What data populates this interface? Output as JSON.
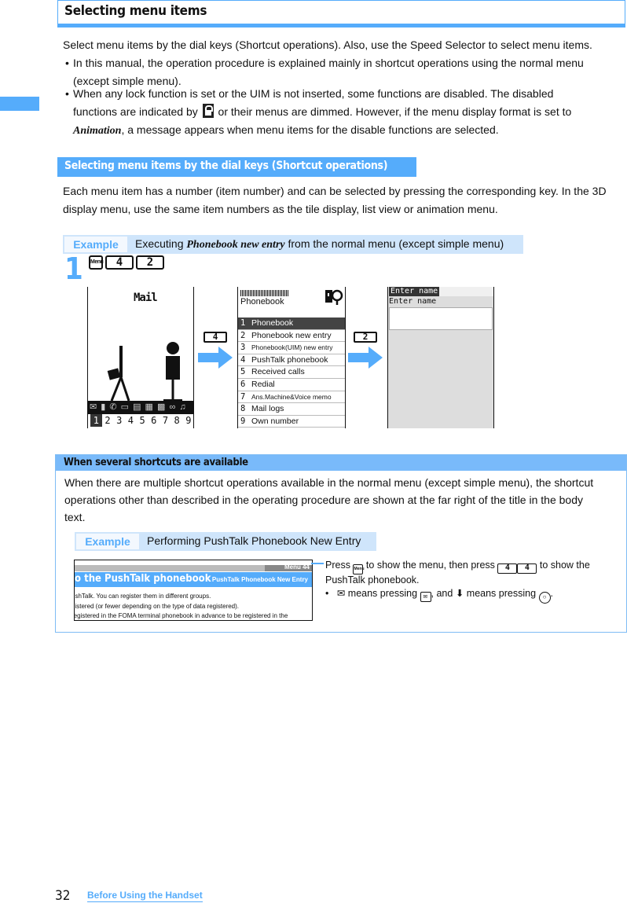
{
  "page": {
    "title": "Selecting menu items",
    "intro": "Select menu items by the dial keys (Shortcut operations). Also, use the Speed Selector to select menu items.",
    "bullets": [
      {
        "line1": "In this manual, the operation procedure is explained mainly in shortcut operations using the normal menu",
        "line2": "(except simple menu)."
      },
      {
        "line1": "When any lock function is set or the UIM is not inserted, some functions are disabled. The disabled",
        "line2_pre": "functions are indicated by",
        "line2_post": "or their menus are dimmed. However, if the menu display format is set to",
        "line3_em": "Animation",
        "line3_rest": ", a message appears when menu items for the disable functions are selected."
      }
    ],
    "lock_icon": "lock-icon"
  },
  "section": {
    "title": "Selecting menu items by the dial keys (Shortcut operations)",
    "line1": "Each menu item has a number (item number) and can be selected by pressing the corresponding key. In the 3D",
    "line2": "display menu, use the same item numbers as the tile display, list view or animation menu."
  },
  "example1": {
    "label": "Example",
    "pre": "Executing",
    "em": "Phonebook new entry",
    "post": "from the normal menu (except simple menu)"
  },
  "step": {
    "number": "1",
    "keys": [
      "Menu",
      "4",
      "2"
    ]
  },
  "screens": {
    "standby": {
      "title": "Mail",
      "icons": "✉ ▮ ✆ ▭ ▤ ▦ ▩ ∞ ♫",
      "numbers": [
        "1",
        "2",
        "3",
        "4",
        "5",
        "6",
        "7",
        "8",
        "9"
      ],
      "selected": "1"
    },
    "arrow1_key": "4",
    "arrow2_key": "2",
    "phonebook": {
      "title": "Phonebook",
      "items": [
        {
          "n": "1",
          "label": "Phonebook",
          "selected": true
        },
        {
          "n": "2",
          "label": "Phonebook new entry"
        },
        {
          "n": "3",
          "label": "Phonebook(UIM) new entry",
          "small": true
        },
        {
          "n": "4",
          "label": "PushTalk phonebook"
        },
        {
          "n": "5",
          "label": "Received calls"
        },
        {
          "n": "6",
          "label": "Redial"
        },
        {
          "n": "7",
          "label": "Ans.Machine&Voice memo",
          "small": true
        },
        {
          "n": "8",
          "label": "Mail logs"
        },
        {
          "n": "9",
          "label": "Own number"
        }
      ]
    },
    "enter_name": {
      "header": "Enter name",
      "label": "Enter name",
      "value": ""
    }
  },
  "note": {
    "title": "When several shortcuts are available",
    "line1": "When there are multiple shortcut operations available in the normal menu (except simple menu), the shortcut",
    "line2": "operations other than described in the operating procedure are shown at the far right of the title in the body",
    "line3": "text.",
    "example": {
      "label": "Example",
      "text": "Performing PushTalk Phonebook New Entry"
    },
    "clip": {
      "menu": "Menu 44",
      "title": "o the PushTalk phonebook",
      "subtitle": "PushTalk Phonebook New Entry",
      "lines": [
        "ushTalk. You can register them in different groups.",
        "gistered (or fewer depending on the type of data registered).",
        "registered in the FOMA terminal phonebook in advance to be registered in the"
      ]
    },
    "explain": {
      "p1": "Press",
      "menu_key": "Menu",
      "p2": "to show the menu, then press",
      "keys": [
        "4",
        "4"
      ],
      "p3": "to show the",
      "p4": "PushTalk phonebook.",
      "b1": "means pressing",
      "b2": ", and",
      "b3": "means pressing",
      "end": "."
    }
  },
  "footer": {
    "page_number": "32",
    "section_link": "Before Using the Handset"
  }
}
